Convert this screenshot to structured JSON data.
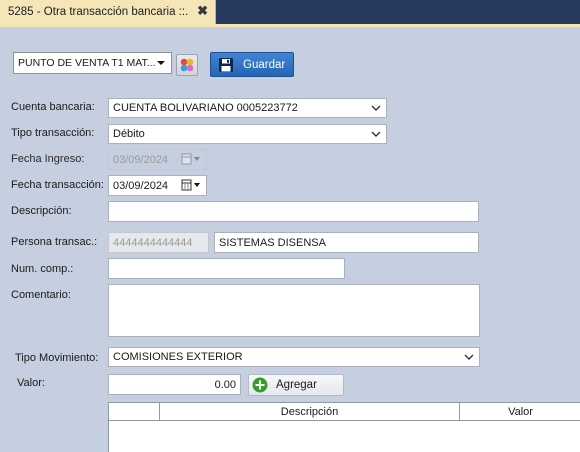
{
  "tab": {
    "title": "5285 - Otra transacción bancaria ::.",
    "close": "✖"
  },
  "toolbar": {
    "point_of_sale": "PUNTO DE VENTA T1 MAT...",
    "save_label": "Guardar"
  },
  "form": {
    "bank_account": {
      "label": "Cuenta bancaria:",
      "value": "CUENTA BOLIVARIANO 0005223772"
    },
    "transaction_type": {
      "label": "Tipo transacción:",
      "value": "Débito"
    },
    "entry_date": {
      "label": "Fecha Ingreso:",
      "value": "03/09/2024"
    },
    "transaction_date": {
      "label": "Fecha transacción:",
      "value": "03/09/2024"
    },
    "description": {
      "label": "Descripción:",
      "value": ""
    },
    "person": {
      "label": "Persona transac.:",
      "id": "4444444444444",
      "name": "SISTEMAS DISENSA"
    },
    "voucher_number": {
      "label": "Num. comp.:",
      "value": ""
    },
    "comment": {
      "label": "Comentario:",
      "value": ""
    },
    "movement_type": {
      "label": "Tipo Movimiento:",
      "value": "COMISIONES EXTERIOR"
    },
    "amount": {
      "label": "Valor:",
      "value": "0.00"
    },
    "add_label": "Agregar"
  },
  "grid": {
    "columns": [
      "",
      "Descripción",
      "Valor"
    ]
  },
  "colors": {
    "tab_active": "#f5e6b8",
    "tab_strip": "#283b5f",
    "background": "#c5cfe0",
    "save_button": "#2f72c4",
    "add_icon": "#3a9a2b"
  }
}
